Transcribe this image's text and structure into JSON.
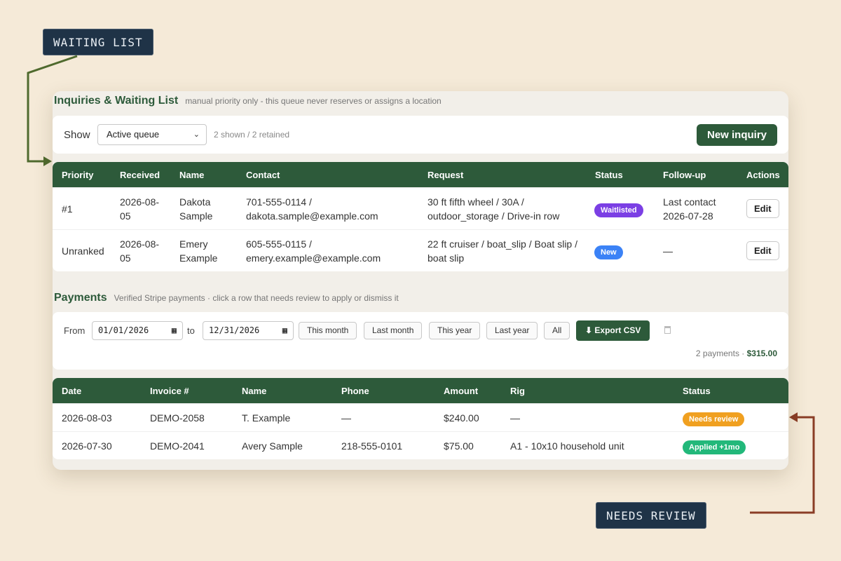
{
  "callouts": {
    "waiting": "WAITING LIST",
    "review": "NEEDS REVIEW"
  },
  "inquiries": {
    "title": "Inquiries & Waiting List",
    "subtitle": "manual priority only - this queue never reserves or assigns a location",
    "show_label": "Show",
    "filter_value": "Active queue",
    "counts": "2 shown / 2 retained",
    "new_button": "New inquiry",
    "columns": [
      "Priority",
      "Received",
      "Name",
      "Contact",
      "Request",
      "Status",
      "Follow-up",
      "Actions"
    ],
    "rows": [
      {
        "priority": "#1",
        "received": [
          "2026-08-",
          "05"
        ],
        "name": [
          "Dakota",
          "Sample"
        ],
        "contact": [
          "701-555-0114 /",
          "dakota.sample@example.com"
        ],
        "request": [
          "30 ft fifth wheel / 30A /",
          "outdoor_storage / Drive-in row"
        ],
        "status": "Waitlisted",
        "status_color": "#7b3fe4",
        "followup": [
          "Last contact",
          "2026-07-28"
        ],
        "action": "Edit"
      },
      {
        "priority": "Unranked",
        "received": [
          "2026-08-",
          "05"
        ],
        "name": [
          "Emery",
          "Example"
        ],
        "contact": [
          "605-555-0115 /",
          "emery.example@example.com"
        ],
        "request": [
          "22 ft cruiser / boat_slip / Boat slip /",
          "boat slip"
        ],
        "status": "New",
        "status_color": "#3b82f6",
        "followup": [
          "—",
          ""
        ],
        "action": "Edit"
      }
    ]
  },
  "payments": {
    "title": "Payments",
    "subtitle": "Verified Stripe payments · click a row that needs review to apply or dismiss it",
    "from_label": "From",
    "from_value": "01/01/2026",
    "to_label": "to",
    "to_value": "12/31/2026",
    "range_buttons": [
      "This month",
      "Last month",
      "This year",
      "Last year",
      "All"
    ],
    "export_label": "⬇ Export CSV",
    "total_prefix": "2 payments · ",
    "total_amount": "$315.00",
    "columns": [
      "Date",
      "Invoice #",
      "Name",
      "Phone",
      "Amount",
      "Rig",
      "Status"
    ],
    "rows": [
      {
        "date": "2026-08-03",
        "invoice": "DEMO-2058",
        "name": "T. Example",
        "phone": "—",
        "amount": "$240.00",
        "rig": "—",
        "status": "Needs review",
        "status_color": "#f0a020"
      },
      {
        "date": "2026-07-30",
        "invoice": "DEMO-2041",
        "name": "Avery Sample",
        "phone": "218-555-0101",
        "amount": "$75.00",
        "rig": "A1 - 10x10 household unit",
        "status": "Applied +1mo",
        "status_color": "#22b87a"
      }
    ]
  },
  "colors": {
    "brand": "#2d5a3a",
    "background": "#f5ead8",
    "callout": "#1f3347"
  }
}
